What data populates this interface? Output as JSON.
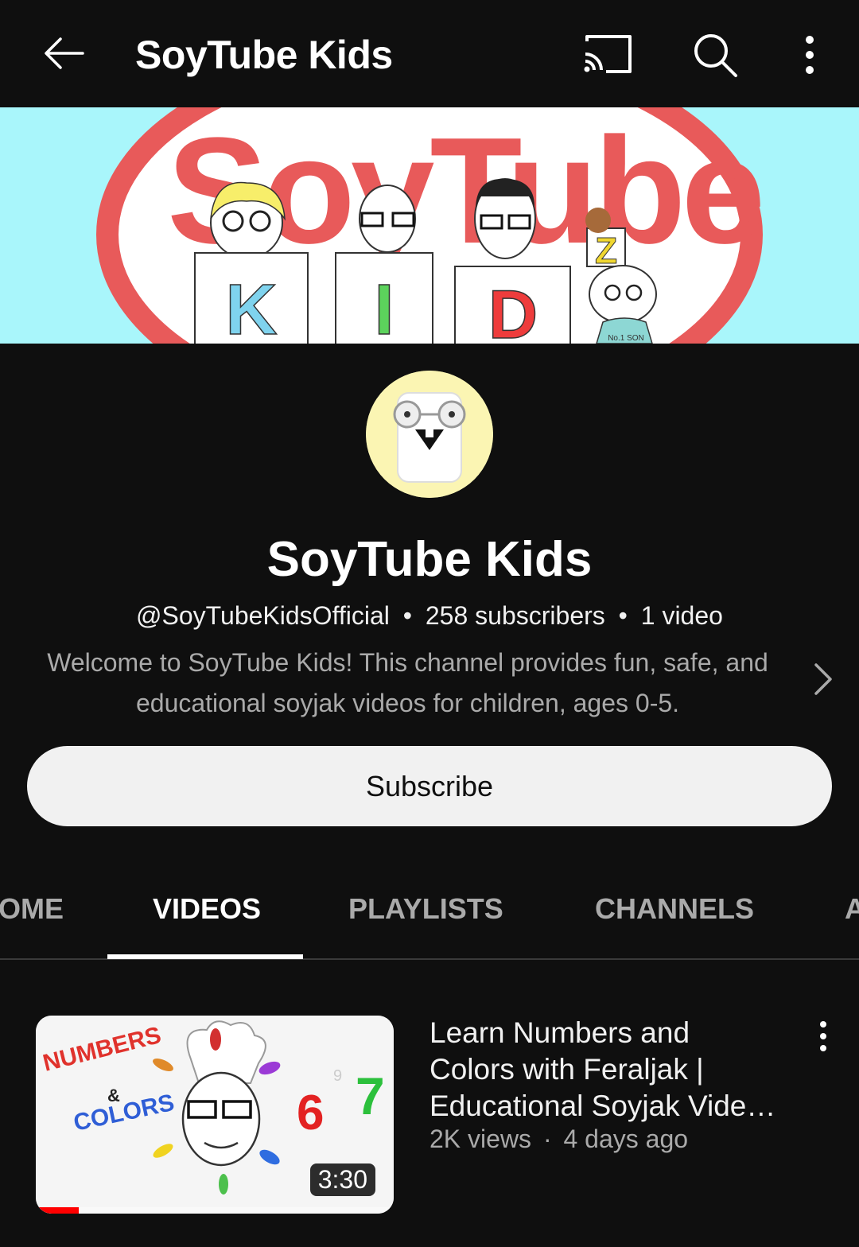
{
  "appbar": {
    "title": "SoyTube Kids",
    "icons": [
      "back-arrow-icon",
      "cast-icon",
      "search-icon",
      "more-vert-icon"
    ]
  },
  "banner": {
    "logo_text": "SoyTube",
    "letters": [
      "K",
      "I",
      "D",
      "Z"
    ],
    "shirt_text": "No.1 SON"
  },
  "channel": {
    "name": "SoyTube Kids",
    "handle": "@SoyTubeKidsOfficial",
    "separator": "•",
    "subscribers": "258 subscribers",
    "video_count": "1 video",
    "description_lines": [
      "Welcome to SoyTube Kids! This channel provides fun, safe, and",
      "educational soyjak videos for children, ages 0-5."
    ],
    "subscribe_label": "Subscribe"
  },
  "tabs": [
    {
      "label": "OME",
      "active": false
    },
    {
      "label": "VIDEOS",
      "active": true
    },
    {
      "label": "PLAYLISTS",
      "active": false
    },
    {
      "label": "CHANNELS",
      "active": false
    },
    {
      "label": "A",
      "active": false
    }
  ],
  "video": {
    "title_lines": [
      "Learn Numbers and",
      "Colors with Feraljak |",
      "Educational Soyjak Vide…"
    ],
    "views": "2K views",
    "dot": "·",
    "age": "4 days ago",
    "duration": "3:30",
    "watch_progress": 0.12,
    "thumb_text": {
      "numbers": "NUMBERS",
      "amp": "&",
      "colors": "COLORS",
      "six": "6",
      "seven": "7",
      "nine": "9"
    }
  },
  "colors": {
    "background": "#0f0f0f",
    "banner_bg": "#a9f6fb",
    "logo_red": "#e85a5a",
    "avatar_bg": "#fbf5b3",
    "progress_red": "#ff0000",
    "secondary_text": "#aaaaaa"
  }
}
